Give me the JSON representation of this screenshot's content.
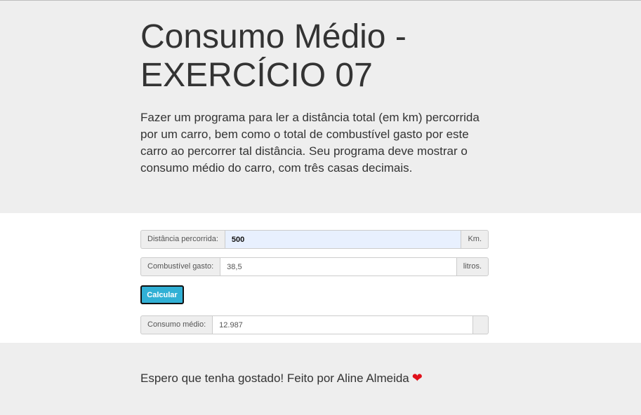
{
  "header": {
    "title": "Consumo Médio - EXERCÍCIO 07",
    "description": "Fazer um programa para ler a distância total (em km) percorrida por um carro, bem como o total de combustível gasto por este carro ao percorrer tal distância. Seu programa deve mostrar o consumo médio do carro, com três casas decimais."
  },
  "form": {
    "distance": {
      "label": "Distância percorrida:",
      "value": "500",
      "unit": "Km."
    },
    "fuel": {
      "label": "Combustível gasto:",
      "value": "38,5",
      "unit": "litros."
    },
    "calculate_label": "Calcular",
    "result": {
      "label": "Consumo médio:",
      "value": "12.987",
      "unit": ""
    }
  },
  "footer": {
    "text": "Espero que tenha gostado! Feito por Aline Almeida",
    "icon": "heart-icon"
  }
}
